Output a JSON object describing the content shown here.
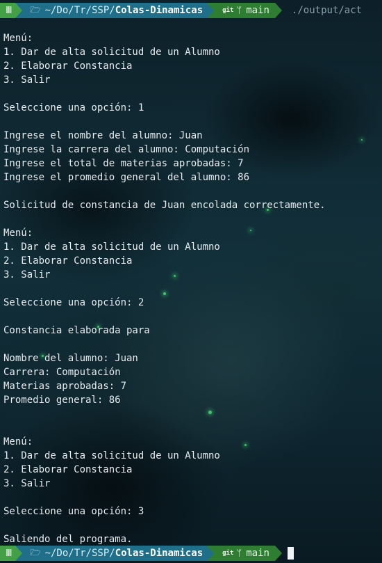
{
  "prompt": {
    "os_icon": "Ⅲ",
    "folder_icon": "folder-icon",
    "path_prefix": "~/Do/Tr/SSP/",
    "path_current": "Colas-Dinamicas",
    "git_label": "git",
    "branch_icon": "branch-icon",
    "branch": "main",
    "command": "./output/act"
  },
  "output_lines": [
    "Menú:",
    "1. Dar de alta solicitud de un Alumno",
    "2. Elaborar Constancia",
    "3. Salir",
    "",
    "Seleccione una opción: 1",
    "",
    "Ingrese el nombre del alumno: Juan",
    "Ingrese la carrera del alumno: Computación",
    "Ingrese el total de materias aprobadas: 7",
    "Ingrese el promedio general del alumno: 86",
    "",
    "Solicitud de constancia de Juan encolada correctamente.",
    "",
    "Menú:",
    "1. Dar de alta solicitud de un Alumno",
    "2. Elaborar Constancia",
    "3. Salir",
    "",
    "Seleccione una opción: 2",
    "",
    "Constancia elaborada para",
    "",
    "Nombre del alumno: Juan",
    "Carrera: Computación",
    "Materias aprobadas: 7",
    "Promedio general: 86",
    "",
    "",
    "Menú:",
    "1. Dar de alta solicitud de un Alumno",
    "2. Elaborar Constancia",
    "3. Salir",
    "",
    "Seleccione una opción: 3",
    "",
    "Saliendo del programa."
  ],
  "colors": {
    "os_segment": "#43a047",
    "path_segment": "#1f6f8b",
    "git_segment": "#2e7d32",
    "text": "#e6ecef"
  }
}
